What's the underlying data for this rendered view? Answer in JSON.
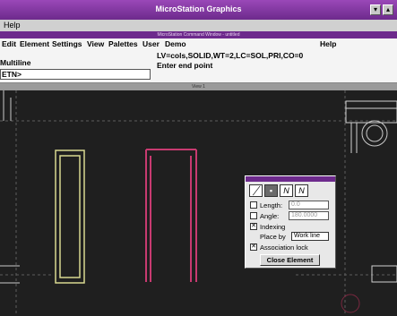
{
  "app": {
    "title": "MicroStation Graphics",
    "minimize_glyph": "▾",
    "maximize_glyph": "▴"
  },
  "top_menu": {
    "help": "Help"
  },
  "command_window": {
    "caption": "MicroStation Command Window - untitled",
    "menus": [
      "Edit",
      "Element",
      "Settings",
      "View",
      "Palettes",
      "User",
      "Demo"
    ],
    "help": "Help",
    "status_line_1": "LV=cols,SOLID,WT=2,LC=SOL,PRI,CO=0",
    "status_line_2": "Enter end point",
    "active_tool": "Multiline",
    "keyin_prompt": "ETN>"
  },
  "view": {
    "caption": "View 1"
  },
  "dialog": {
    "mode_icons": [
      "line-mode-icon",
      "fill-mode-icon",
      "join-mode-icon",
      "join-alt-mode-icon"
    ],
    "length_label": "Length:",
    "length_value": "0.0",
    "angle_label": "Angle:",
    "angle_value": "180.0000",
    "indexing_label": "Indexing",
    "indexing_checked": true,
    "place_by_label": "Place by",
    "place_by_value": "Work line",
    "association_label": "Association lock",
    "association_checked": true,
    "close_button": "Close Element"
  },
  "colors": {
    "title_bar": "#6d2a8c",
    "canvas": "#1f1f1f",
    "yellow_element": "#d8d890",
    "magenta_element": "#c83a70",
    "grid": "#6a6a6a"
  }
}
